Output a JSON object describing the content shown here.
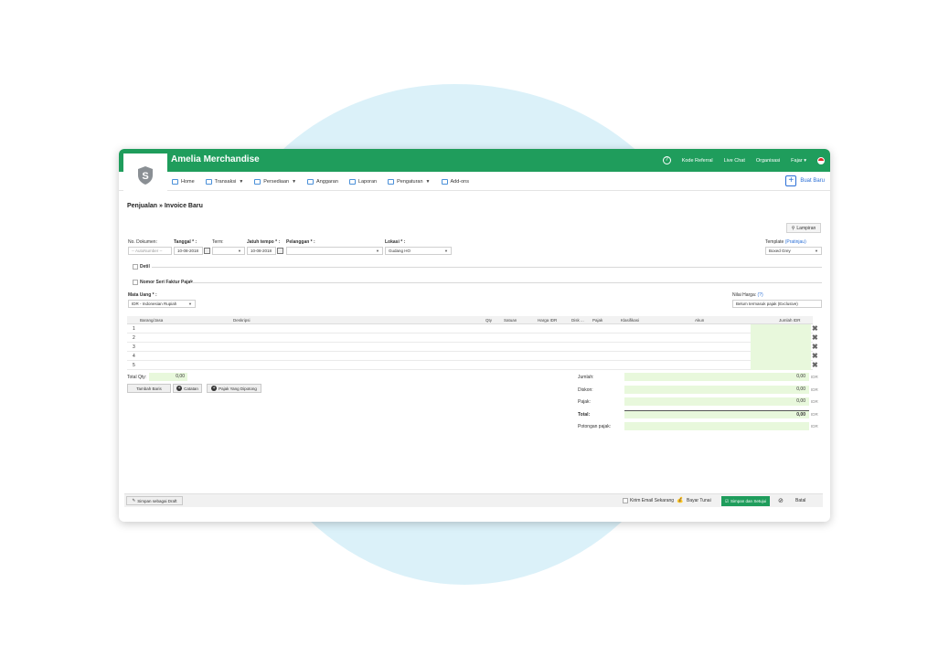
{
  "colors": {
    "brand_green": "#1f9d5c",
    "link_blue": "#2b6fd6",
    "input_green": "#e8f8dc",
    "background_blob": "#dbf1f9"
  },
  "header": {
    "logo_letter": "S",
    "app_title": "Amelia Merchandise",
    "help_icon": "?",
    "links": [
      "Kode Referral",
      "Live Chat",
      "Organisasi"
    ],
    "user": "Fajar"
  },
  "menu": {
    "items": [
      {
        "label": "Home",
        "icon": "home-icon",
        "dropdown": false
      },
      {
        "label": "Transaksi",
        "icon": "transaction-icon",
        "dropdown": true
      },
      {
        "label": "Persediaan",
        "icon": "inventory-icon",
        "dropdown": true
      },
      {
        "label": "Anggaran",
        "icon": "budget-icon",
        "dropdown": false
      },
      {
        "label": "Laporan",
        "icon": "report-icon",
        "dropdown": false
      },
      {
        "label": "Pengaturan",
        "icon": "settings-icon",
        "dropdown": true
      },
      {
        "label": "Add-ons",
        "icon": "addons-icon",
        "dropdown": false
      }
    ],
    "new_button": "Buat Baru"
  },
  "page": {
    "breadcrumb": "Penjualan » Invoice Baru",
    "attachment_button": "Lampiran"
  },
  "form": {
    "doc_no": {
      "label": "No. Dokumen:",
      "placeholder": "-- AutoNumber --"
    },
    "date": {
      "label": "Tanggal * :",
      "value": "10-08-2018"
    },
    "term": {
      "label": "Term:",
      "value": ""
    },
    "due_date": {
      "label": "Jatuh tempo * :",
      "value": "10-08-2018"
    },
    "customer": {
      "label": "Pelanggan * :",
      "value": ""
    },
    "location": {
      "label": "Lokasi * :",
      "value": "Gudang HO"
    },
    "template": {
      "label": "Template",
      "preview": "(Pratinjau)",
      "value": "Boxed Grey"
    },
    "detail_check": "Detil",
    "tax_serial_check": "Nomor Seri Faktur Pajak",
    "currency": {
      "label": "Mata Uang * :",
      "value": "IDR - Indonesian Rupiah"
    },
    "price_value": {
      "label": "Nilai Harga:",
      "help": "(?)",
      "value": "Belum termasuk pajak (Exclusive)"
    }
  },
  "table": {
    "columns": [
      "Barang/Jasa",
      "Deskripsi",
      "Qty",
      "Satuan",
      "Harga IDR",
      "Disk ...",
      "Pajak",
      "Klasifikasi",
      "Akun",
      "Jumlah IDR"
    ],
    "rows": [
      "1",
      "2",
      "3",
      "4",
      "5"
    ],
    "delete_icon": "✖"
  },
  "summary": {
    "total_qty_label": "Total Qty:",
    "total_qty_value": "0,00",
    "add_row_button": "Tambah Baris",
    "note_button": "Catatan",
    "withheld_tax_button": "Pajak Yang Dipotong",
    "totals": [
      {
        "label": "Jumlah:",
        "value": "0,00",
        "currency": "IDR",
        "bold": false
      },
      {
        "label": "Diskon:",
        "value": "0,00",
        "currency": "IDR",
        "bold": false
      },
      {
        "label": "Pajak:",
        "value": "0,00",
        "currency": "IDR",
        "bold": false
      },
      {
        "label": "Total:",
        "value": "0,00",
        "currency": "IDR",
        "bold": true
      },
      {
        "label": "Potongan pajak:",
        "value": "",
        "currency": "IDR",
        "bold": false
      }
    ]
  },
  "footer": {
    "save_draft": "Simpan sebagai Draft",
    "send_email": "Kirim Email Sekarang",
    "pay_cash": "Bayar Tunai",
    "save_approve": "Simpan dan Setujui",
    "cancel": "Batal"
  }
}
